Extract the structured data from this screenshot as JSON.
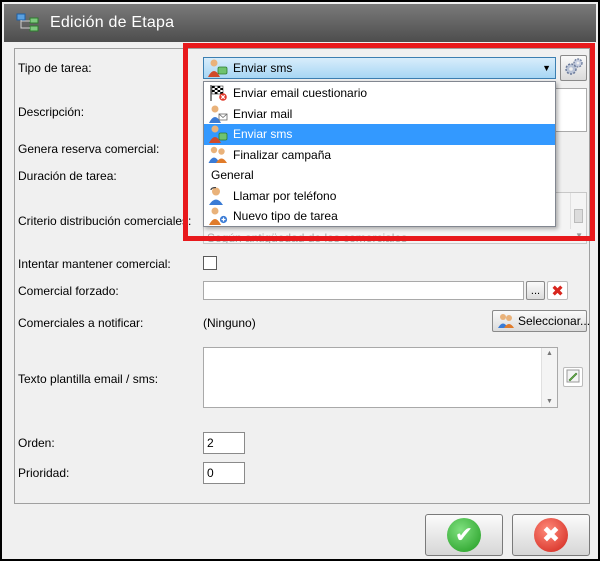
{
  "window": {
    "title": "Edición de Etapa",
    "title_icon": "hierarchy-icon"
  },
  "form": {
    "tipo_tarea_label": "Tipo de tarea:",
    "tipo_tarea_value": "Enviar sms",
    "descripcion_label": "Descripción:",
    "genera_reserva_label": "Genera reserva comercial:",
    "duracion_label": "Duración de tarea:",
    "criterio_label": "Criterio distribución comerciales:",
    "criterio_value": "Según antigüedad de los comerciales",
    "intentar_label": "Intentar mantener comercial:",
    "comercial_forzado_label": "Comercial forzado:",
    "comercial_forzado_browse": "...",
    "comerciales_notificar_label": "Comerciales a notificar:",
    "comerciales_notificar_value": "(Ninguno)",
    "seleccionar_label": "Seleccionar...",
    "texto_plantilla_label": "Texto plantilla email / sms:",
    "orden_label": "Orden:",
    "orden_value": "2",
    "prioridad_label": "Prioridad:",
    "prioridad_value": "0"
  },
  "dropdown": {
    "items": [
      {
        "label": "Enviar email cuestionario",
        "icon": "checkered-flag-icon",
        "selected": false
      },
      {
        "label": "Enviar mail",
        "icon": "person-mail-icon",
        "selected": false
      },
      {
        "label": "Enviar sms",
        "icon": "person-sms-icon",
        "selected": true
      },
      {
        "label": "Finalizar campaña",
        "icon": "people-icon",
        "selected": false
      },
      {
        "label": "General",
        "icon": "",
        "selected": false
      },
      {
        "label": "Llamar por teléfono",
        "icon": "person-phone-icon",
        "selected": false
      },
      {
        "label": "Nuevo tipo de tarea",
        "icon": "person-add-icon",
        "selected": false
      }
    ]
  },
  "colors": {
    "highlight": "#e8191c",
    "selection": "#3399ff",
    "ok": "#2fb52f",
    "cancel": "#e0352b"
  }
}
